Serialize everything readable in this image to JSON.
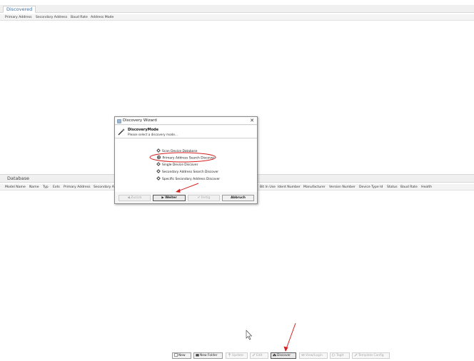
{
  "discovered": {
    "tab_label": "Discovered",
    "columns": [
      "Primary Address",
      "Secondary Address",
      "Baud Rate",
      "Address Mode"
    ]
  },
  "database": {
    "tab_label": "Database",
    "columns_left": [
      "Model Name",
      "Name",
      "Typ",
      "Exts",
      "Primary Address",
      "Secondary A"
    ],
    "columns_right": [
      "Bit In Use",
      "Ident Number",
      "Manufacturer",
      "Version Number",
      "Device Type Id",
      "Status",
      "Baud Rate",
      "Health"
    ]
  },
  "dialog": {
    "title": "Discovery Wizard",
    "close": "✕",
    "heading": "DiscoveryMode",
    "subheading": "Please select a discovery mode...",
    "options": [
      {
        "label": "Scan Device Database",
        "selected": false
      },
      {
        "label": "Primary Address Search Discover",
        "selected": true
      },
      {
        "label": "Single Device Discover",
        "selected": false
      },
      {
        "label": "Secondary Address Search Discover",
        "selected": false
      },
      {
        "label": "Specific Secondary Address Discover",
        "selected": false
      }
    ],
    "buttons": {
      "back": "◀ Zurück",
      "next": "▶ Weiter",
      "finish": "✔ Fertig",
      "cancel": "Abbruch"
    }
  },
  "toolbar": {
    "new": "New",
    "new_folder": "New Folder",
    "update": "Update",
    "edit": "Edit",
    "discover": "Discover",
    "view_login": "View/Login",
    "tagit": "TagIt",
    "template_config": "Template Config"
  },
  "colors": {
    "accent": "#3a6ea5",
    "annotation_red": "#d62020"
  }
}
